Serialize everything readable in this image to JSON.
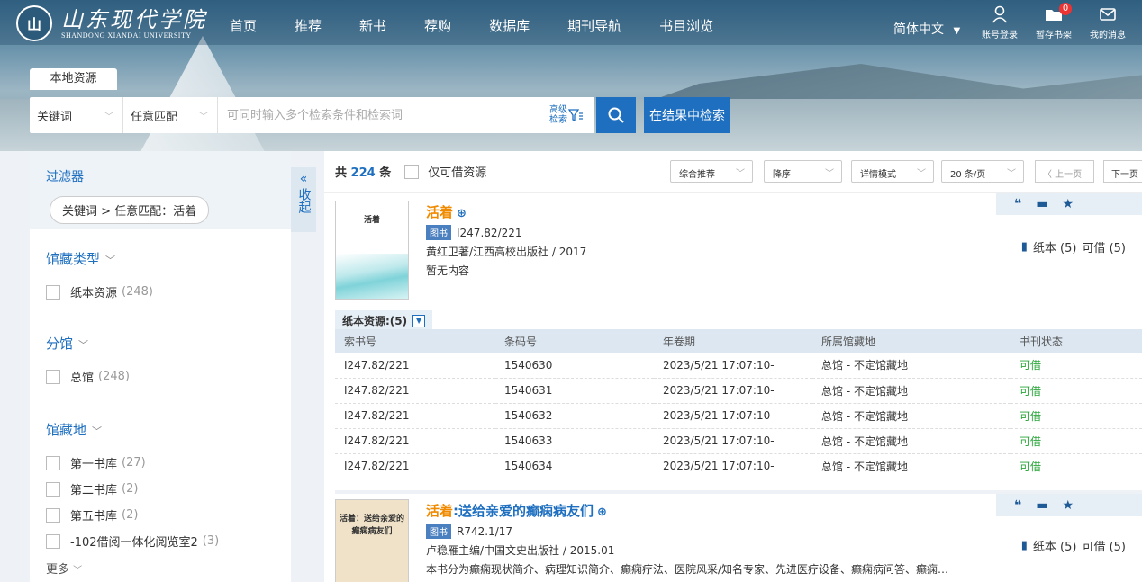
{
  "header": {
    "logo_cn": "山东现代学院",
    "logo_en": "SHANDONG XIANDAI UNIVERSITY",
    "nav": [
      "首页",
      "推荐",
      "新书",
      "荐购",
      "数据库",
      "期刊导航",
      "书目浏览"
    ],
    "language": "简体中文",
    "account_label": "账号登录",
    "shelf_label": "暂存书架",
    "shelf_count": "0",
    "message_label": "我的消息"
  },
  "search": {
    "resource_tab": "本地资源",
    "field_select": "关键词",
    "match_select": "任意匹配",
    "placeholder": "可同时输入多个检索条件和检索词",
    "advanced_line1": "高级",
    "advanced_line2": "检索",
    "in_results": "在结果中检索"
  },
  "filters": {
    "title": "过滤器",
    "active_chip": "关键词 > 任意匹配：活着",
    "collapse_label": "收起",
    "groups": [
      {
        "title": "馆藏类型",
        "options": [
          {
            "label": "纸本资源",
            "count": "(248)"
          }
        ]
      },
      {
        "title": "分馆",
        "options": [
          {
            "label": "总馆",
            "count": "(248)"
          }
        ]
      },
      {
        "title": "馆藏地",
        "options": [
          {
            "label": "第一书库",
            "count": "(27)"
          },
          {
            "label": "第二书库",
            "count": "(2)"
          },
          {
            "label": "第五书库",
            "count": "(2)"
          },
          {
            "label": "-102借阅一体化阅览室2",
            "count": "(3)"
          }
        ]
      }
    ],
    "more": "更多"
  },
  "toolbar": {
    "total_prefix": "共",
    "total": "224",
    "total_suffix": "条",
    "available_only": "仅可借资源",
    "sort": "综合推荐",
    "order": "降序",
    "view": "详情模式",
    "per_page": "20 条/页",
    "prev": "〈 上一页",
    "next": "下一页"
  },
  "results": [
    {
      "cover_title": "活着",
      "title": "活着",
      "title_rest": "",
      "type_tag": "图书",
      "call_no": "I247.82/221",
      "author_pub": "黄红卫著/江西高校出版社 / 2017",
      "summary": "暂无内容",
      "stock": "纸本 (5)",
      "available": "可借 (5)",
      "holdings_label": "纸本资源:(5)",
      "holdings_headers": [
        "索书号",
        "条码号",
        "年卷期",
        "所属馆藏地",
        "书刊状态"
      ],
      "holdings": [
        [
          "I247.82/221",
          "1540630",
          "2023/5/21 17:07:10-",
          "总馆 - 不定馆藏地",
          "可借"
        ],
        [
          "I247.82/221",
          "1540631",
          "2023/5/21 17:07:10-",
          "总馆 - 不定馆藏地",
          "可借"
        ],
        [
          "I247.82/221",
          "1540632",
          "2023/5/21 17:07:10-",
          "总馆 - 不定馆藏地",
          "可借"
        ],
        [
          "I247.82/221",
          "1540633",
          "2023/5/21 17:07:10-",
          "总馆 - 不定馆藏地",
          "可借"
        ],
        [
          "I247.82/221",
          "1540634",
          "2023/5/21 17:07:10-",
          "总馆 - 不定馆藏地",
          "可借"
        ]
      ]
    },
    {
      "cover_title": "活着：送给亲爱的癫痫病友们",
      "title": "活着",
      "title_rest": ":送给亲爱的癫痫病友们",
      "type_tag": "图书",
      "call_no": "R742.1/17",
      "author_pub": "卢稳雁主编/中国文史出版社 / 2015.01",
      "summary": "本书分为癫痫现状简介、病理知识简介、癫痫疗法、医院风采/知名专家、先进医疗设备、癫痫病问答、癫痫…",
      "stock": "纸本 (5)",
      "available": "可借 (5)"
    }
  ],
  "icons": {
    "account": "user-icon",
    "shelf": "folder-icon",
    "message": "mail-icon",
    "search": "search-icon",
    "filter": "funnel-icon",
    "cite": "quote-icon",
    "save": "folder-icon",
    "favorite": "star-icon"
  },
  "colors": {
    "accent": "#1e6fc0",
    "title_orange": "#f08a00",
    "available_green": "#2aa63a"
  }
}
